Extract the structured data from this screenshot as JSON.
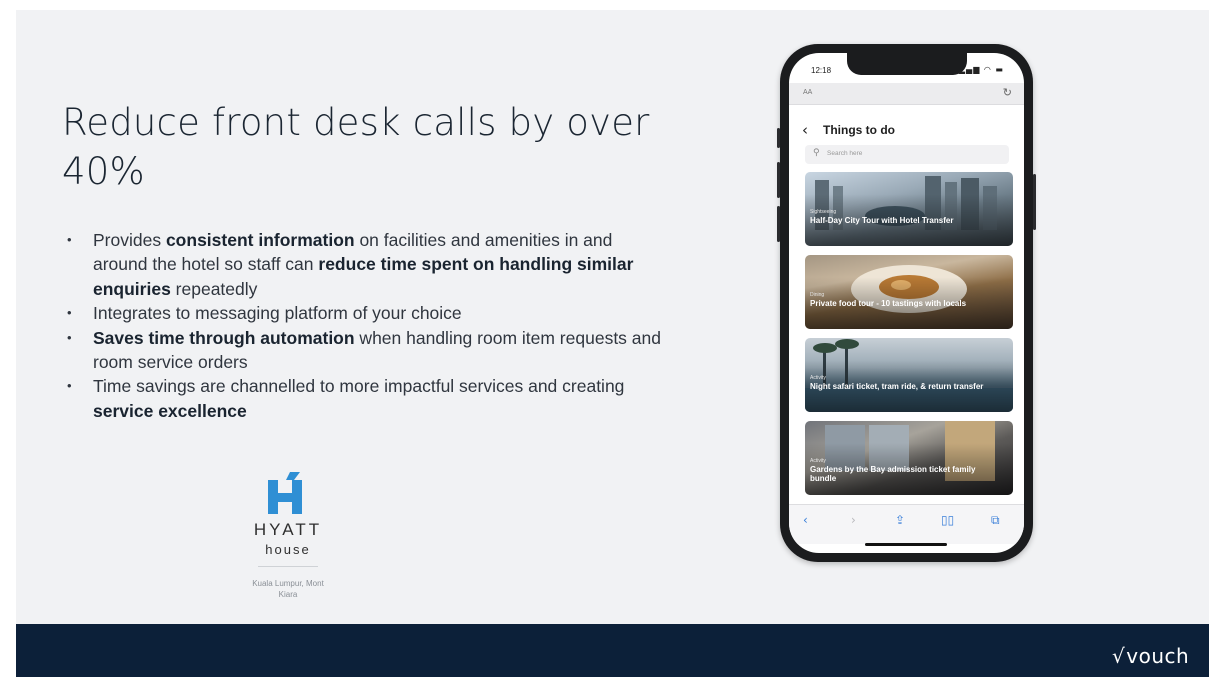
{
  "slide": {
    "headline": "Reduce front desk calls by over 40%",
    "bullets": [
      {
        "parts": [
          {
            "text": "Provides ",
            "bold": false
          },
          {
            "text": "consistent information",
            "bold": true
          },
          {
            "text": " on facilities and amenities in and around the hotel so staff can ",
            "bold": false
          },
          {
            "text": "reduce time spent on handling similar enquiries",
            "bold": true
          },
          {
            "text": " repeatedly",
            "bold": false
          }
        ]
      },
      {
        "parts": [
          {
            "text": "Integrates to messaging platform of your choice",
            "bold": false
          }
        ]
      },
      {
        "parts": [
          {
            "text": "Saves time through automation",
            "bold": true
          },
          {
            "text": " when handling room item requests and room service orders",
            "bold": false
          }
        ]
      },
      {
        "parts": [
          {
            "text": "Time savings are channelled to more impactful services and creating ",
            "bold": false
          },
          {
            "text": "service excellence",
            "bold": true
          }
        ]
      }
    ]
  },
  "hotel_logo": {
    "brand_line1": "HYATT",
    "brand_line2": "house",
    "location": "Kuala Lumpur, Mont Kiara",
    "color": "#2f8fd4"
  },
  "phone": {
    "status_time": "12:18",
    "url_aa": "AA",
    "page_title": "Things to do",
    "search_placeholder": "Search here",
    "cards": [
      {
        "category": "Sightseeing",
        "title": "Half-Day City Tour with Hotel Transfer"
      },
      {
        "category": "Dining",
        "title": "Private food tour - 10 tastings with locals"
      },
      {
        "category": "Activity",
        "title": "Night safari ticket, tram ride, & return transfer"
      },
      {
        "category": "Activity",
        "title": "Gardens by the Bay admission ticket family bundle"
      }
    ],
    "toolbar_icons": [
      "back-icon",
      "forward-icon",
      "share-icon",
      "bookmarks-icon",
      "tabs-icon"
    ],
    "accent_color": "#3a7fd9"
  },
  "footer": {
    "brand": "vouch",
    "background": "#0c2039"
  }
}
